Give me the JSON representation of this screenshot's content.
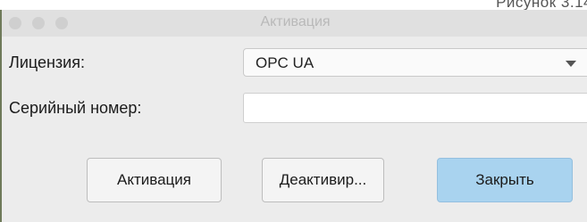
{
  "background": {
    "caption": "Рисунок 3.14"
  },
  "window": {
    "title": "Активация"
  },
  "form": {
    "license_label": "Лицензия:",
    "license_value": "OPC UA",
    "serial_label": "Серийный номер:",
    "serial_value": ""
  },
  "buttons": {
    "activate": "Активация",
    "deactivate": "Деактивир...",
    "close": "Закрыть"
  },
  "colors": {
    "primary_button": "#a9d3ef",
    "dialog_bg": "#ececec"
  }
}
